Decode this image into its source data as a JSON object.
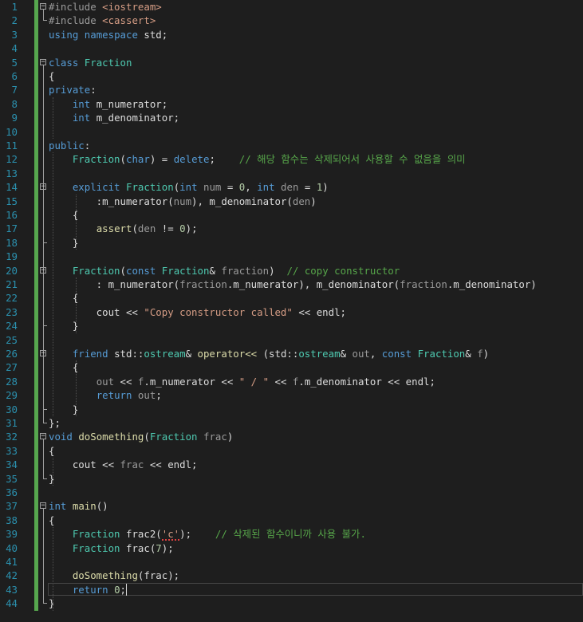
{
  "editor": {
    "lines": [
      {
        "n": "1",
        "tokens": [
          [
            "pp",
            "#include "
          ],
          [
            "st",
            "<iostream>"
          ]
        ]
      },
      {
        "n": "2",
        "tokens": [
          [
            "pp",
            "#include "
          ],
          [
            "st",
            "<cassert>"
          ]
        ]
      },
      {
        "n": "3",
        "tokens": [
          [
            "kw",
            "using"
          ],
          [
            "",
            " "
          ],
          [
            "kw",
            "namespace"
          ],
          [
            "",
            " std;"
          ]
        ]
      },
      {
        "n": "4",
        "tokens": []
      },
      {
        "n": "5",
        "tokens": [
          [
            "kw",
            "class"
          ],
          [
            "",
            " "
          ],
          [
            "ty",
            "Fraction"
          ]
        ]
      },
      {
        "n": "6",
        "tokens": [
          [
            "",
            "{"
          ]
        ]
      },
      {
        "n": "7",
        "tokens": [
          [
            "kw",
            "private"
          ],
          [
            "",
            ":"
          ]
        ]
      },
      {
        "n": "8",
        "tokens": [
          [
            "",
            "    "
          ],
          [
            "kw",
            "int"
          ],
          [
            "",
            " m_numerator;"
          ]
        ]
      },
      {
        "n": "9",
        "tokens": [
          [
            "",
            "    "
          ],
          [
            "kw",
            "int"
          ],
          [
            "",
            " m_denominator;"
          ]
        ]
      },
      {
        "n": "10",
        "tokens": []
      },
      {
        "n": "11",
        "tokens": [
          [
            "kw",
            "public"
          ],
          [
            "",
            ":"
          ]
        ]
      },
      {
        "n": "12",
        "tokens": [
          [
            "",
            "    "
          ],
          [
            "ty",
            "Fraction"
          ],
          [
            "",
            "("
          ],
          [
            "kw",
            "char"
          ],
          [
            "",
            ") = "
          ],
          [
            "kw",
            "delete"
          ],
          [
            "",
            ";    "
          ],
          [
            "cm",
            "// 해당 함수는 삭제되어서 사용할 수 없음을 의미"
          ]
        ]
      },
      {
        "n": "13",
        "tokens": []
      },
      {
        "n": "14",
        "tokens": [
          [
            "",
            "    "
          ],
          [
            "kw",
            "explicit"
          ],
          [
            "",
            " "
          ],
          [
            "ty",
            "Fraction"
          ],
          [
            "",
            "("
          ],
          [
            "kw",
            "int"
          ],
          [
            "",
            " "
          ],
          [
            "pr",
            "num"
          ],
          [
            "",
            " = "
          ],
          [
            "nm",
            "0"
          ],
          [
            "",
            ", "
          ],
          [
            "kw",
            "int"
          ],
          [
            "",
            " "
          ],
          [
            "pr",
            "den"
          ],
          [
            "",
            " = "
          ],
          [
            "nm",
            "1"
          ],
          [
            "",
            ")"
          ]
        ]
      },
      {
        "n": "15",
        "tokens": [
          [
            "",
            "        :m_numerator("
          ],
          [
            "pr",
            "num"
          ],
          [
            "",
            "), m_denominator("
          ],
          [
            "pr",
            "den"
          ],
          [
            "",
            ")"
          ]
        ]
      },
      {
        "n": "16",
        "tokens": [
          [
            "",
            "    {"
          ]
        ]
      },
      {
        "n": "17",
        "tokens": [
          [
            "",
            "        "
          ],
          [
            "fn",
            "assert"
          ],
          [
            "",
            "("
          ],
          [
            "pr",
            "den"
          ],
          [
            "",
            " != "
          ],
          [
            "nm",
            "0"
          ],
          [
            "",
            ");"
          ]
        ]
      },
      {
        "n": "18",
        "tokens": [
          [
            "",
            "    }"
          ]
        ]
      },
      {
        "n": "19",
        "tokens": []
      },
      {
        "n": "20",
        "tokens": [
          [
            "",
            "    "
          ],
          [
            "ty",
            "Fraction"
          ],
          [
            "",
            "("
          ],
          [
            "kw",
            "const"
          ],
          [
            "",
            " "
          ],
          [
            "ty",
            "Fraction"
          ],
          [
            "",
            "& "
          ],
          [
            "pr",
            "fraction"
          ],
          [
            "",
            ")  "
          ],
          [
            "cm",
            "// copy constructor"
          ]
        ]
      },
      {
        "n": "21",
        "tokens": [
          [
            "",
            "        : m_numerator("
          ],
          [
            "pr",
            "fraction"
          ],
          [
            "",
            ".m_numerator), m_denominator("
          ],
          [
            "pr",
            "fraction"
          ],
          [
            "",
            ".m_denominator)"
          ]
        ]
      },
      {
        "n": "22",
        "tokens": [
          [
            "",
            "    {"
          ]
        ]
      },
      {
        "n": "23",
        "tokens": [
          [
            "",
            "        cout << "
          ],
          [
            "st",
            "\"Copy constructor called\""
          ],
          [
            "",
            " << endl;"
          ]
        ]
      },
      {
        "n": "24",
        "tokens": [
          [
            "",
            "    }"
          ]
        ]
      },
      {
        "n": "25",
        "tokens": []
      },
      {
        "n": "26",
        "tokens": [
          [
            "",
            "    "
          ],
          [
            "kw",
            "friend"
          ],
          [
            "",
            " std::"
          ],
          [
            "ty",
            "ostream"
          ],
          [
            "",
            "& "
          ],
          [
            "fn",
            "operator<<"
          ],
          [
            "",
            " (std::"
          ],
          [
            "ty",
            "ostream"
          ],
          [
            "",
            "& "
          ],
          [
            "pr",
            "out"
          ],
          [
            "",
            ", "
          ],
          [
            "kw",
            "const"
          ],
          [
            "",
            " "
          ],
          [
            "ty",
            "Fraction"
          ],
          [
            "",
            "& "
          ],
          [
            "pr",
            "f"
          ],
          [
            "",
            ")"
          ]
        ]
      },
      {
        "n": "27",
        "tokens": [
          [
            "",
            "    {"
          ]
        ]
      },
      {
        "n": "28",
        "tokens": [
          [
            "",
            "        "
          ],
          [
            "pr",
            "out"
          ],
          [
            "",
            " << "
          ],
          [
            "pr",
            "f"
          ],
          [
            "",
            ".m_numerator << "
          ],
          [
            "st",
            "\" / \""
          ],
          [
            "",
            " << "
          ],
          [
            "pr",
            "f"
          ],
          [
            "",
            ".m_denominator << endl;"
          ]
        ]
      },
      {
        "n": "29",
        "tokens": [
          [
            "",
            "        "
          ],
          [
            "kw",
            "return"
          ],
          [
            "",
            " "
          ],
          [
            "pr",
            "out"
          ],
          [
            "",
            ";"
          ]
        ]
      },
      {
        "n": "30",
        "tokens": [
          [
            "",
            "    }"
          ]
        ]
      },
      {
        "n": "31",
        "tokens": [
          [
            "",
            "};"
          ]
        ]
      },
      {
        "n": "32",
        "tokens": [
          [
            "kw",
            "void"
          ],
          [
            "",
            " "
          ],
          [
            "fn",
            "doSomething"
          ],
          [
            "",
            "("
          ],
          [
            "ty",
            "Fraction"
          ],
          [
            "",
            " "
          ],
          [
            "pr",
            "frac"
          ],
          [
            "",
            ")"
          ]
        ]
      },
      {
        "n": "33",
        "tokens": [
          [
            "",
            "{"
          ]
        ]
      },
      {
        "n": "34",
        "tokens": [
          [
            "",
            "    cout << "
          ],
          [
            "pr",
            "frac"
          ],
          [
            "",
            " << endl;"
          ]
        ]
      },
      {
        "n": "35",
        "tokens": [
          [
            "",
            "}"
          ]
        ]
      },
      {
        "n": "36",
        "tokens": []
      },
      {
        "n": "37",
        "tokens": [
          [
            "kw",
            "int"
          ],
          [
            "",
            " "
          ],
          [
            "fn",
            "main"
          ],
          [
            "",
            "()"
          ]
        ]
      },
      {
        "n": "38",
        "tokens": [
          [
            "",
            "{"
          ]
        ]
      },
      {
        "n": "39",
        "tokens": [
          [
            "",
            "    "
          ],
          [
            "ty",
            "Fraction"
          ],
          [
            "",
            " frac2("
          ],
          [
            "st",
            "'c'"
          ],
          [
            "",
            ");    "
          ],
          [
            "cm",
            "// 삭제된 함수이니까 사용 불가."
          ]
        ]
      },
      {
        "n": "40",
        "tokens": [
          [
            "",
            "    "
          ],
          [
            "ty",
            "Fraction"
          ],
          [
            "",
            " frac("
          ],
          [
            "nm",
            "7"
          ],
          [
            "",
            ");"
          ]
        ]
      },
      {
        "n": "41",
        "tokens": []
      },
      {
        "n": "42",
        "tokens": [
          [
            "",
            "    "
          ],
          [
            "fn",
            "doSomething"
          ],
          [
            "",
            "(frac);"
          ]
        ]
      },
      {
        "n": "43",
        "tokens": [
          [
            "",
            "    "
          ],
          [
            "kw",
            "return"
          ],
          [
            "",
            " "
          ],
          [
            "nm",
            "0"
          ],
          [
            "",
            ";"
          ]
        ]
      },
      {
        "n": "44",
        "tokens": [
          [
            "",
            "}"
          ]
        ]
      }
    ]
  }
}
